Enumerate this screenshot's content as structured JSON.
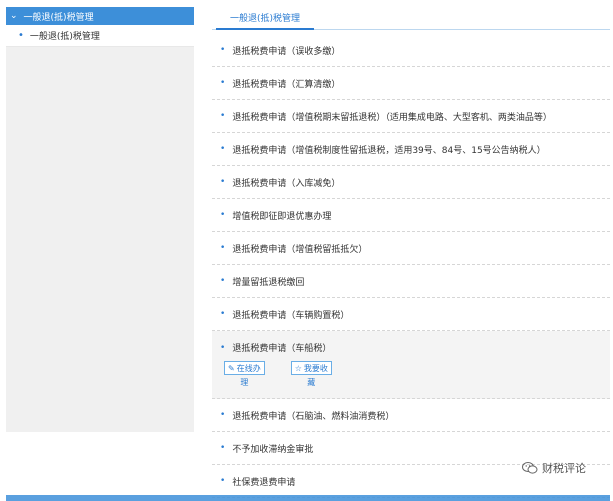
{
  "sidebar": {
    "header": "一般退(抵)税管理",
    "items": [
      {
        "label": "一般退(抵)税管理"
      }
    ]
  },
  "main": {
    "tab": "一般退(抵)税管理",
    "rows": [
      {
        "label": "退抵税费申请（误收多缴）"
      },
      {
        "label": "退抵税费申请（汇算清缴）"
      },
      {
        "label": "退抵税费申请（增值税期末留抵退税）（适用集成电路、大型客机、两类油品等）"
      },
      {
        "label": "退抵税费申请（增值税制度性留抵退税，适用39号、84号、15号公告纳税人）"
      },
      {
        "label": "退抵税费申请（入库减免）"
      },
      {
        "label": "增值税即征即退优惠办理"
      },
      {
        "label": "退抵税费申请（增值税留抵抵欠）"
      },
      {
        "label": "增量留抵退税缴回"
      },
      {
        "label": "退抵税费申请（车辆购置税）"
      }
    ],
    "expanded_row": {
      "label": "退抵税费申请（车船税）",
      "btn_online": "在线办",
      "btn_online_tail": "理",
      "btn_collect": "我要收",
      "btn_collect_tail": "藏"
    },
    "rows_after": [
      {
        "label": "退抵税费申请（石脑油、燃料油消费税）"
      },
      {
        "label": "不予加收滞纳金审批"
      },
      {
        "label": "社保费退费申请"
      }
    ]
  },
  "watermark": {
    "text": "财税评论"
  }
}
